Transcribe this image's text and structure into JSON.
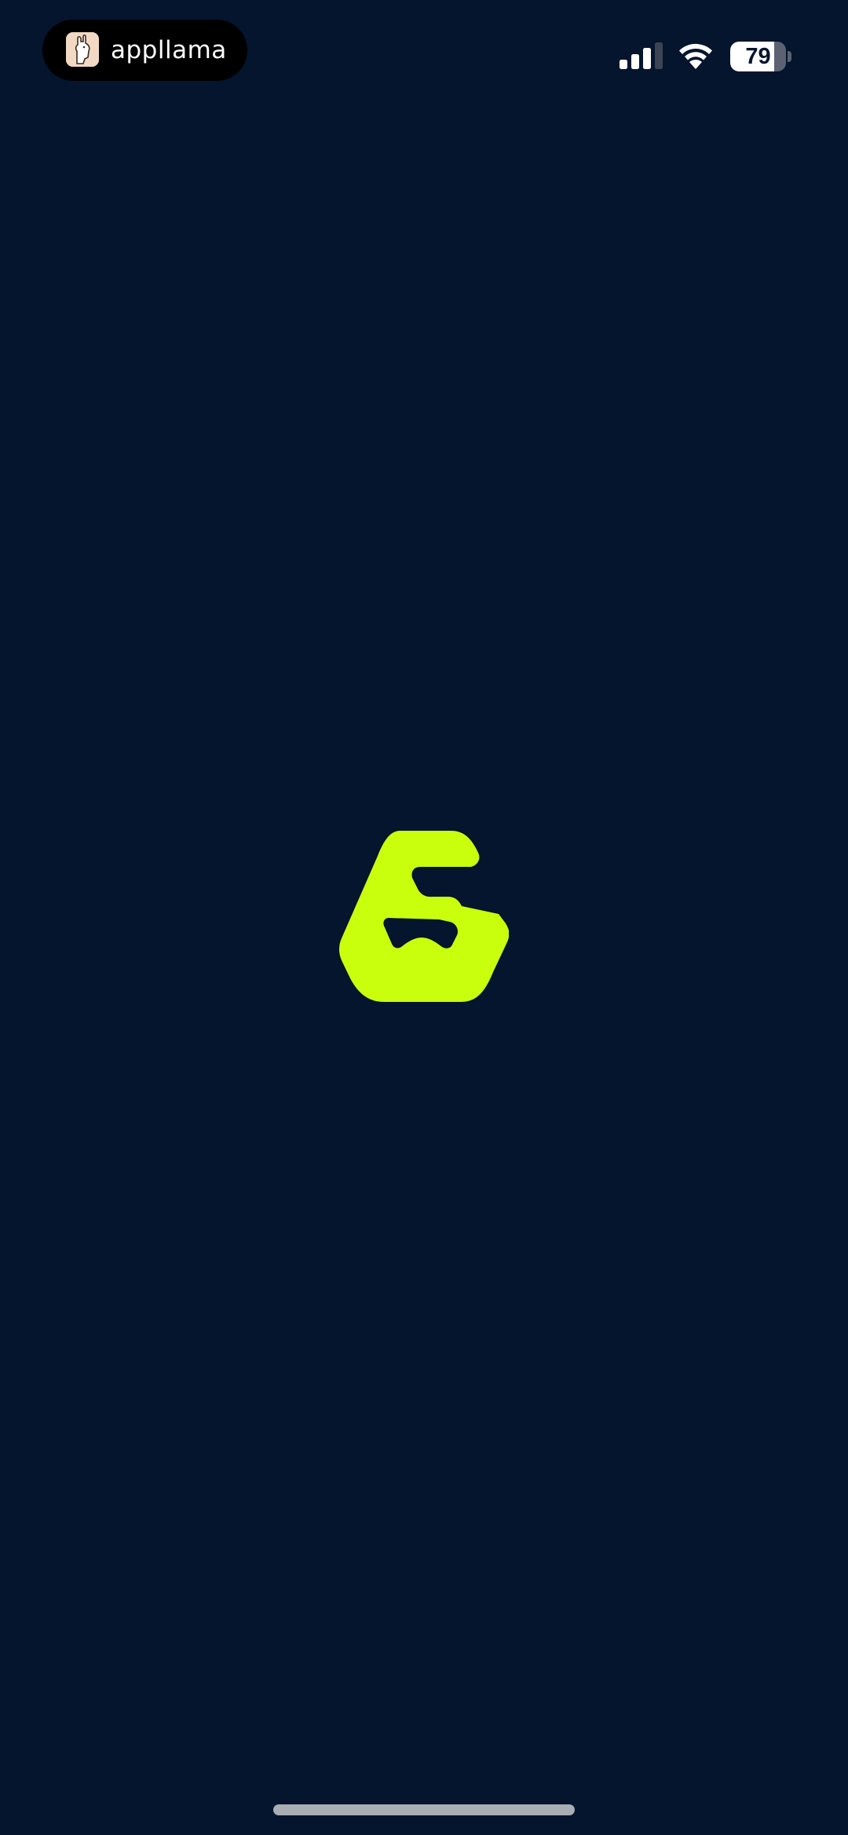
{
  "status_bar": {
    "app_name": "appllama",
    "battery_percent": "79",
    "battery_level": 0.79,
    "signal_bars_active": 3,
    "signal_bars_total": 4,
    "icons": [
      "appllama-icon",
      "signal-icon",
      "wifi-icon",
      "battery-icon"
    ]
  },
  "splash": {
    "logo_icon": "app-logo-g-icon",
    "logo_color": "#c9ff0d",
    "background_color": "#04152d"
  }
}
